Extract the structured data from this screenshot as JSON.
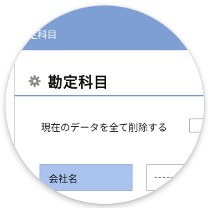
{
  "window": {
    "title": "勘定科目"
  },
  "page": {
    "title": "勘定科目",
    "icon": "gear-icon"
  },
  "delete_option": {
    "label": "現在のデータを全て削除する",
    "checked": false
  },
  "company": {
    "label": "会社名",
    "selected_value": "--------"
  },
  "colors": {
    "accent": "#7e9fd3",
    "label_cell": "#a9c2ee"
  }
}
